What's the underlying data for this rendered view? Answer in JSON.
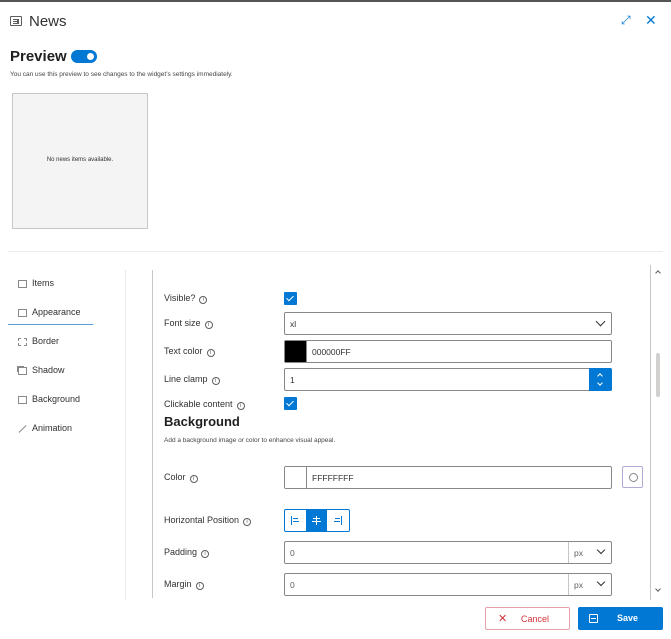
{
  "header": {
    "title": "News",
    "app_icon": "news-icon",
    "expand_icon": "expand-icon",
    "close_icon": "close-icon"
  },
  "preview": {
    "title": "Preview",
    "toggle_on": true,
    "description": "You can use this preview to see changes to the widget's settings immediately.",
    "empty_message": "No news items available."
  },
  "nav": {
    "active": "Appearance",
    "items": [
      {
        "label": "Items",
        "icon": "items-icon"
      },
      {
        "label": "Appearance",
        "icon": "appearance-icon"
      },
      {
        "label": "Border",
        "icon": "border-icon"
      },
      {
        "label": "Shadow",
        "icon": "shadow-icon"
      },
      {
        "label": "Background",
        "icon": "background-icon"
      },
      {
        "label": "Animation",
        "icon": "animation-icon"
      }
    ]
  },
  "appearance": {
    "visible": {
      "label": "Visible?",
      "checked": true
    },
    "font_size": {
      "label": "Font size",
      "value": "xl"
    },
    "text_color": {
      "label": "Text color",
      "value": "000000FF",
      "swatch": "#000000"
    },
    "line_clamp": {
      "label": "Line clamp",
      "value": "1"
    },
    "clickable": {
      "label": "Clickable content",
      "checked": true
    }
  },
  "background": {
    "title": "Background",
    "description": "Add a background image or color to enhance visual appeal.",
    "color": {
      "label": "Color",
      "value": "FFFFFFFF",
      "swatch": "#FFFFFF"
    },
    "horizontal_position": {
      "label": "Horizontal Position",
      "options": [
        "left",
        "center",
        "right"
      ],
      "selected": "center"
    },
    "padding": {
      "label": "Padding",
      "value": "0",
      "unit": "px"
    },
    "margin": {
      "label": "Margin",
      "value": "0",
      "unit": "px"
    }
  },
  "footer": {
    "cancel_label": "Cancel",
    "save_label": "Save"
  },
  "colors": {
    "accent": "#0078d4",
    "danger": "#d13438"
  }
}
